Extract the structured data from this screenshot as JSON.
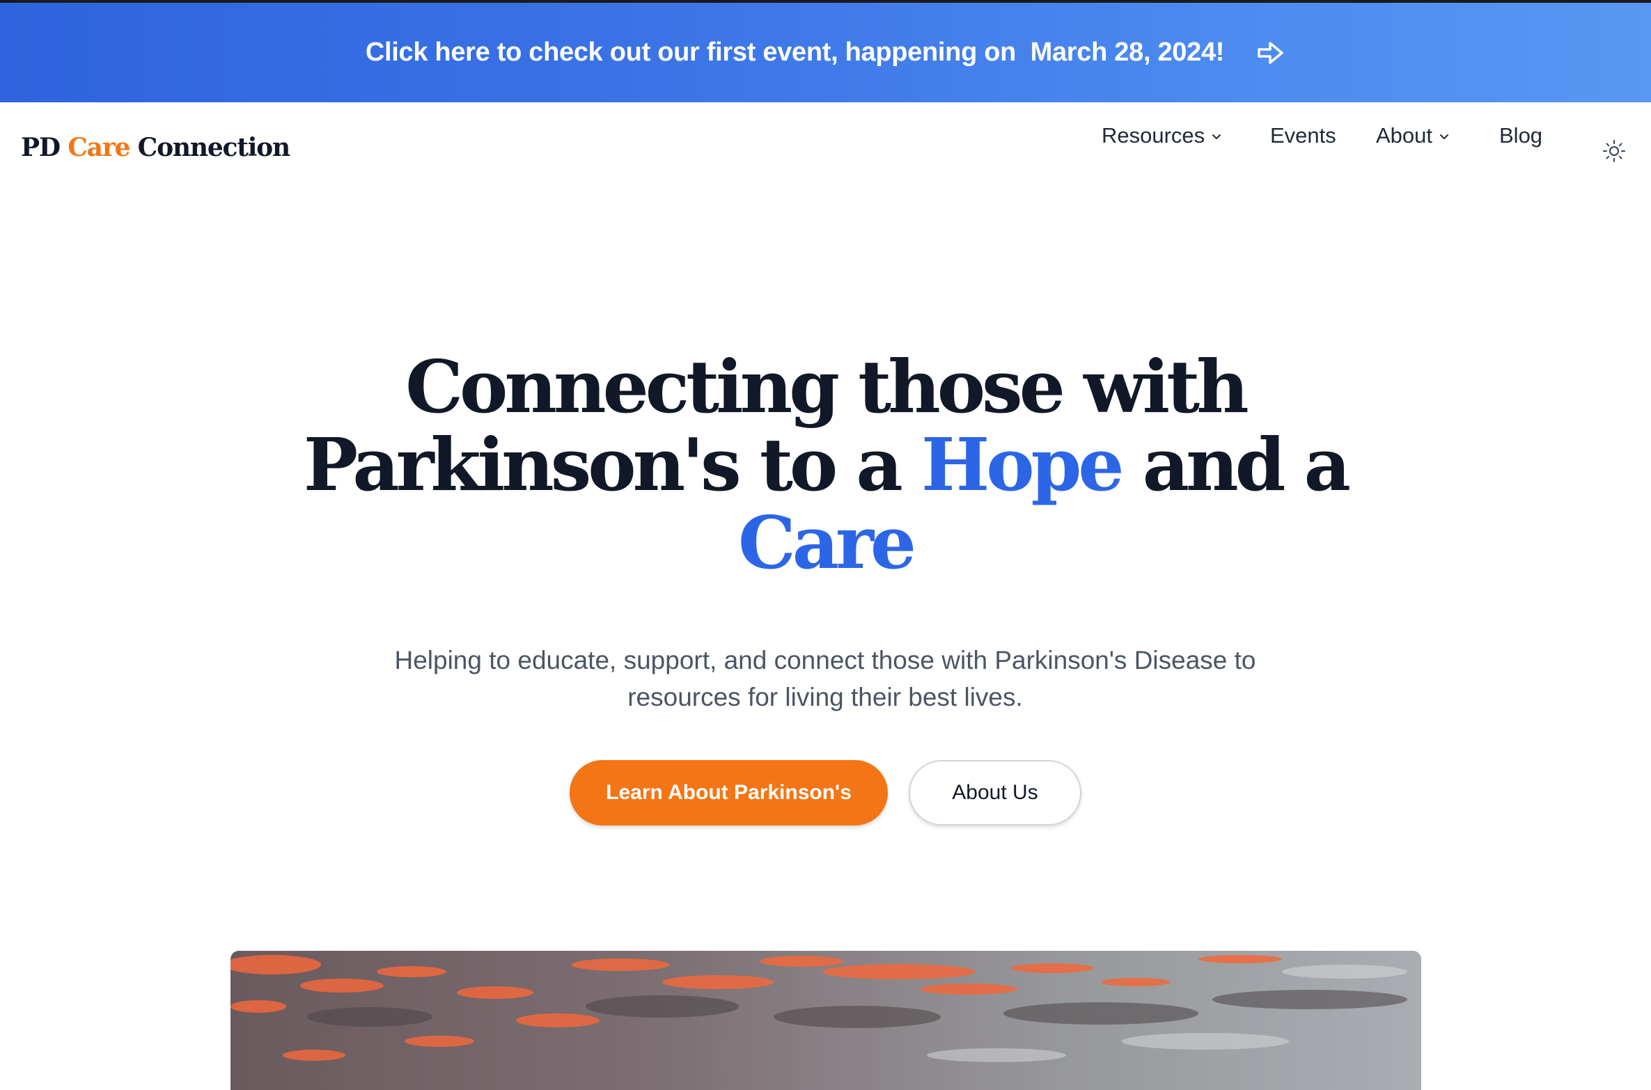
{
  "banner": {
    "text": "Click here to check out our first event, happening on  March 28, 2024!",
    "icon": "arrow-right-icon"
  },
  "header": {
    "logo": {
      "part1": "PD ",
      "part2": "Care",
      "part3": " Connection"
    },
    "nav": {
      "resources": "Resources",
      "events": "Events",
      "about": "About",
      "blog": "Blog"
    },
    "theme_toggle_icon": "sun-icon"
  },
  "hero": {
    "title": {
      "line1": "Connecting those with",
      "line2_a": "Parkinson's to a ",
      "line2_hl": "Hope",
      "line2_b": " and a",
      "line3_hl": "Care"
    },
    "subtitle": "Helping to educate, support, and connect those with Parkinson's Disease to resources for living their best lives.",
    "primary_button": "Learn About Parkinson's",
    "secondary_button": "About Us"
  },
  "colors": {
    "brand_orange": "#f47515",
    "brand_blue": "#2c66e6",
    "text_dark": "#111827",
    "text_muted": "#4b5563",
    "banner_start": "#2f63df",
    "banner_end": "#5897f2"
  }
}
